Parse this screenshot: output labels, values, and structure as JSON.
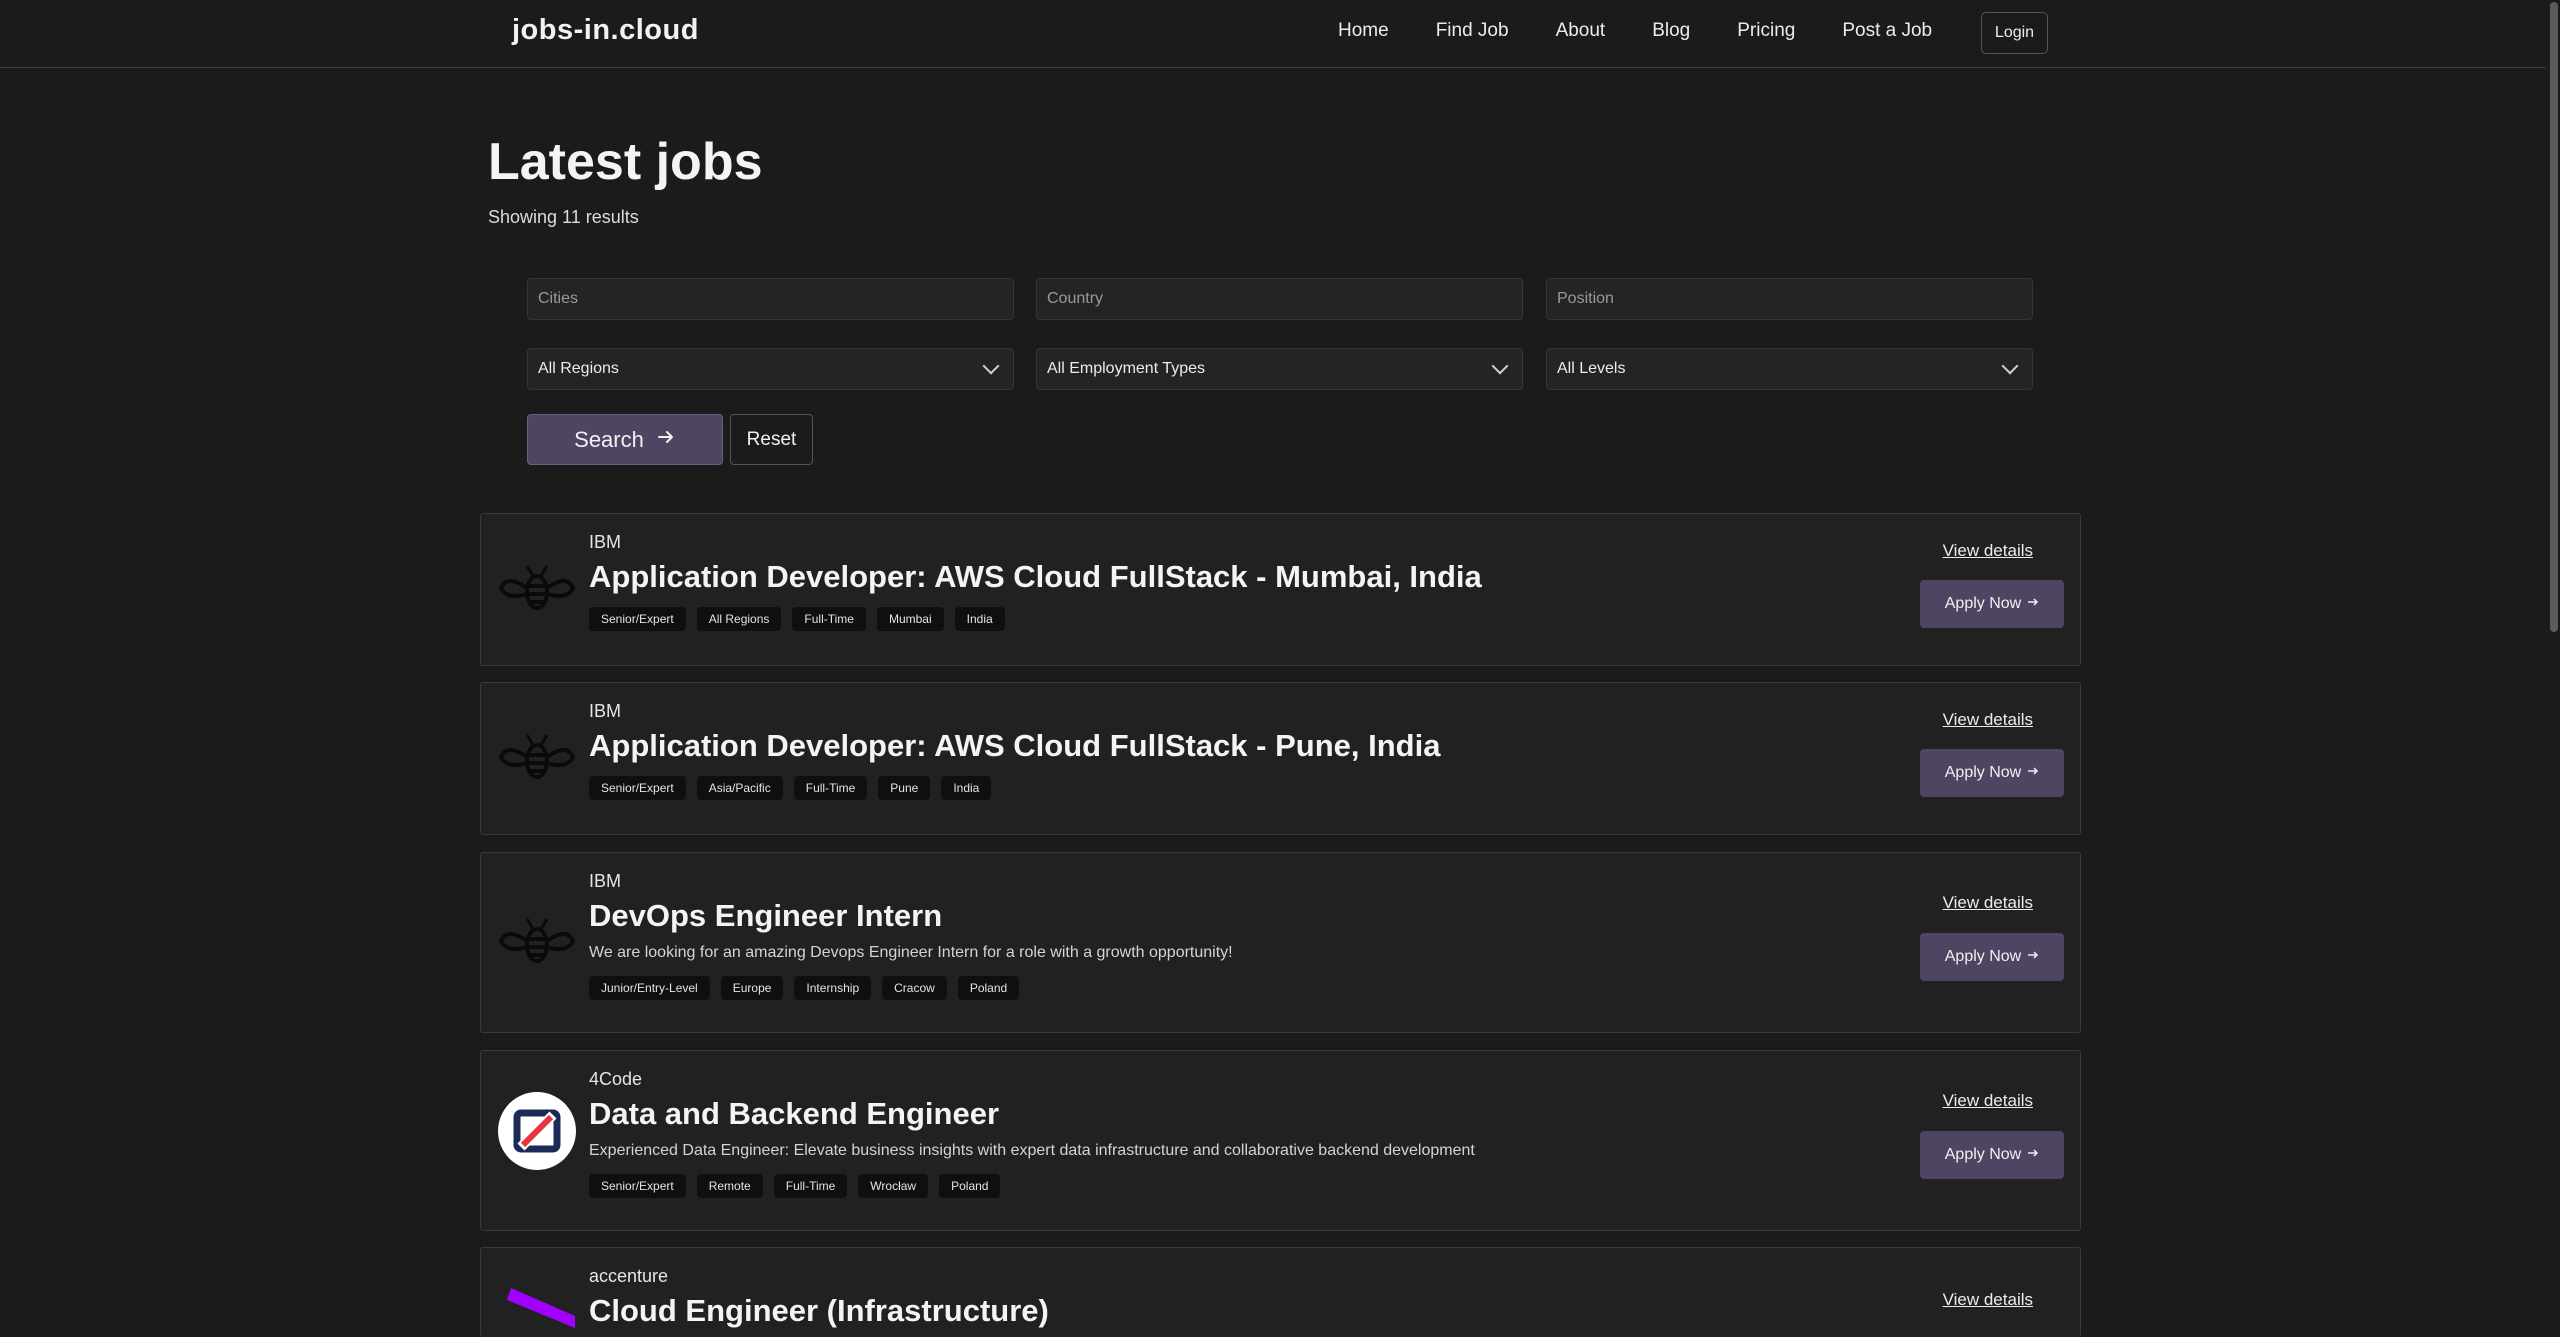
{
  "header": {
    "brand": "jobs-in.cloud",
    "nav": [
      "Home",
      "Find Job",
      "About",
      "Blog",
      "Pricing",
      "Post a Job"
    ],
    "login": "Login"
  },
  "page": {
    "title": "Latest jobs",
    "results": "Showing 11 results"
  },
  "filters": {
    "cities_placeholder": "Cities",
    "country_placeholder": "Country",
    "position_placeholder": "Position",
    "region": "All Regions",
    "employment_type": "All Employment Types",
    "level": "All Levels",
    "search_label": "Search",
    "reset_label": "Reset"
  },
  "jobs": [
    {
      "company": "IBM",
      "title": "Application Developer: AWS Cloud FullStack - Mumbai, India",
      "description": "",
      "tags": [
        "Senior/Expert",
        "All Regions",
        "Full-Time",
        "Mumbai",
        "India"
      ],
      "logo": "ibm-bee-icon"
    },
    {
      "company": "IBM",
      "title": "Application Developer: AWS Cloud FullStack - Pune, India",
      "description": "",
      "tags": [
        "Senior/Expert",
        "Asia/Pacific",
        "Full-Time",
        "Pune",
        "India"
      ],
      "logo": "ibm-bee-icon"
    },
    {
      "company": "IBM",
      "title": "DevOps Engineer Intern",
      "description": "We are looking for an amazing Devops Engineer Intern for a role with a growth opportunity!",
      "tags": [
        "Junior/Entry-Level",
        "Europe",
        "Internship",
        "Cracow",
        "Poland"
      ],
      "logo": "ibm-bee-icon"
    },
    {
      "company": "4Code",
      "title": "Data and Backend Engineer",
      "description": "Experienced Data Engineer: Elevate business insights with expert data infrastructure and collaborative backend development",
      "tags": [
        "Senior/Expert",
        "Remote",
        "Full-Time",
        "Wrocław",
        "Poland"
      ],
      "logo": "4code-logo-icon"
    },
    {
      "company": "accenture",
      "title": "Cloud Engineer (Infrastructure)",
      "description": "",
      "tags": [],
      "logo": "accenture-logo-icon"
    }
  ],
  "card_actions": {
    "view": "View details",
    "apply": "Apply Now"
  },
  "colors": {
    "background": "#1b1b1b",
    "card": "#212121",
    "accent_button": "#4f4563",
    "accenture_purple": "#a100ff",
    "4code_red": "#e8343f",
    "4code_navy": "#1d2a56"
  }
}
